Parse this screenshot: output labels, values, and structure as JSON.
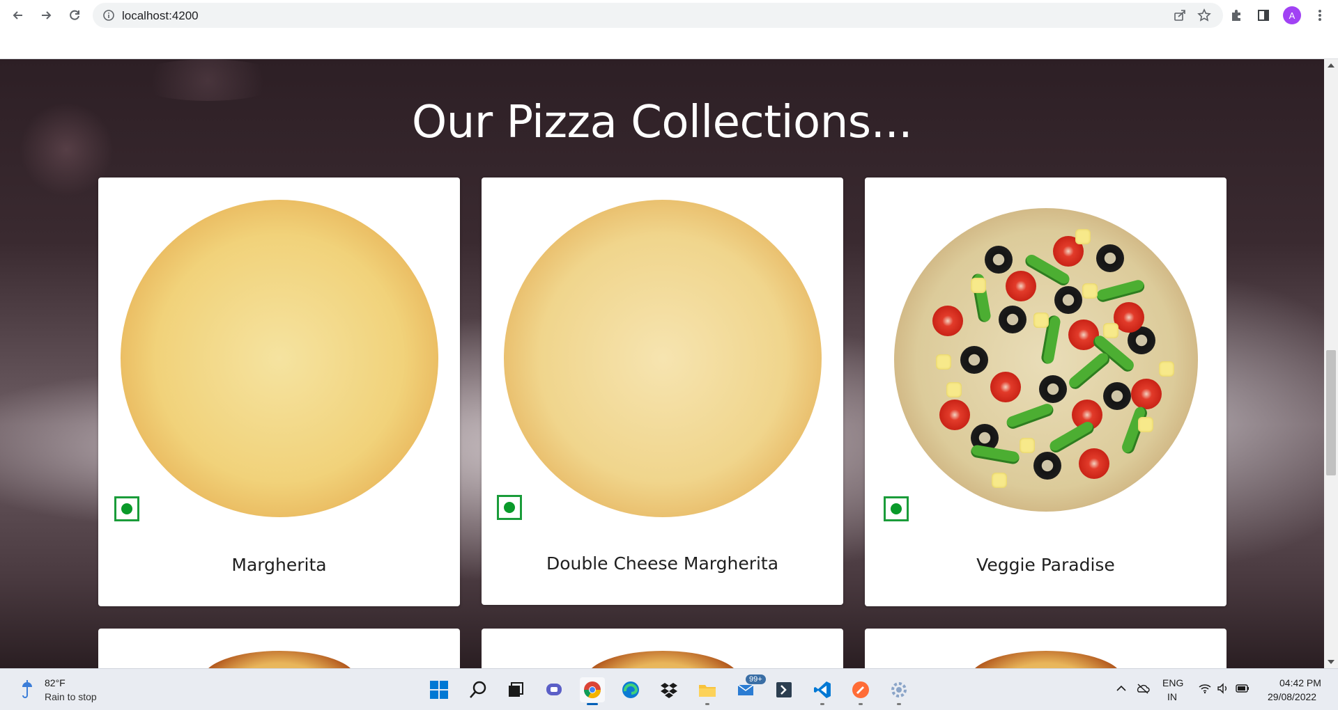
{
  "browser": {
    "url": "localhost:4200",
    "profile_initial": "A"
  },
  "page": {
    "heading": "Our Pizza Collections...",
    "pizzas": [
      {
        "name": "Margherita",
        "veg": true
      },
      {
        "name": "Double Cheese Margherita",
        "veg": true
      },
      {
        "name": "Veggie Paradise",
        "veg": true
      }
    ]
  },
  "taskbar": {
    "weather_temp": "82°F",
    "weather_desc": "Rain to stop",
    "mail_badge": "99+",
    "lang_line1": "ENG",
    "lang_line2": "IN",
    "time": "04:42 PM",
    "date": "29/08/2022"
  },
  "colors": {
    "veg_mark": "#1a9c3a",
    "profile_avatar": "#a142f4",
    "heading_text": "#ffffff"
  }
}
